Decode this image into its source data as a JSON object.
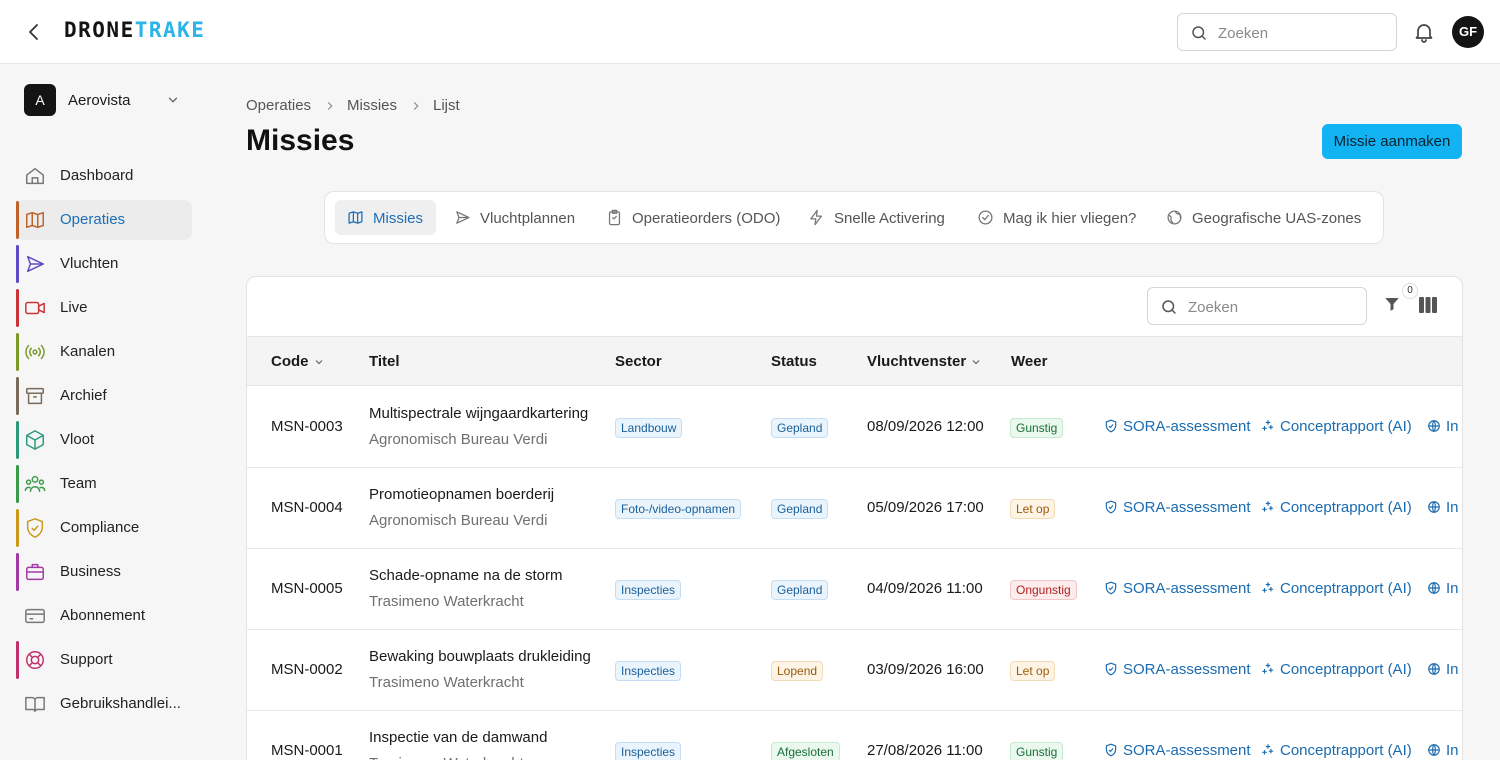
{
  "header": {
    "logo_part1": "DRONE",
    "logo_part2": "TRAKE",
    "search_placeholder": "Zoeken",
    "avatar_initials": "GF"
  },
  "sidebar": {
    "org_initial": "A",
    "org_name": "Aerovista",
    "items": [
      {
        "label": "Dashboard",
        "icon": "home-icon",
        "color": ""
      },
      {
        "label": "Operaties",
        "icon": "map-icon",
        "color": "#c0622a"
      },
      {
        "label": "Vluchten",
        "icon": "send-icon",
        "color": "#5b4bc4"
      },
      {
        "label": "Live",
        "icon": "video-icon",
        "color": "#c8343a"
      },
      {
        "label": "Kanalen",
        "icon": "broadcast-icon",
        "color": "#7a9a2a"
      },
      {
        "label": "Archief",
        "icon": "archive-icon",
        "color": "#7a6a5a"
      },
      {
        "label": "Vloot",
        "icon": "box-icon",
        "color": "#2a9a7a"
      },
      {
        "label": "Team",
        "icon": "users-icon",
        "color": "#3a9a4a"
      },
      {
        "label": "Compliance",
        "icon": "shield-icon",
        "color": "#c99a1a"
      },
      {
        "label": "Business",
        "icon": "briefcase-icon",
        "color": "#a23aa6"
      },
      {
        "label": "Abonnement",
        "icon": "credit-card-icon",
        "color": ""
      },
      {
        "label": "Support",
        "icon": "lifebuoy-icon",
        "color": "#c0306a"
      },
      {
        "label": "Gebruikshandlei...",
        "icon": "book-icon",
        "color": ""
      }
    ]
  },
  "breadcrumb": [
    "Operaties",
    "Missies",
    "Lijst"
  ],
  "page_title": "Missies",
  "create_button": "Missie aanmaken",
  "tabs": [
    {
      "label": "Missies",
      "icon": "map-icon"
    },
    {
      "label": "Vluchtplannen",
      "icon": "send-icon"
    },
    {
      "label": "Operatieorders (ODO)",
      "icon": "clipboard-icon"
    },
    {
      "label": "Snelle Activering",
      "icon": "zap-icon"
    },
    {
      "label": "Mag ik hier vliegen?",
      "icon": "check-circle-icon"
    },
    {
      "label": "Geografische UAS-zones",
      "icon": "globe-icon"
    }
  ],
  "table": {
    "search_placeholder": "Zoeken",
    "filter_count": "0",
    "columns": [
      "Code",
      "Titel",
      "Sector",
      "Status",
      "Vluchtvenster",
      "Weer"
    ],
    "actions": [
      "SORA-assessment",
      "Conceptrapport (AI)",
      "In"
    ],
    "rows": [
      {
        "code": "MSN-0003",
        "title": "Multispectrale wijngaardkartering",
        "client": "Agronomisch Bureau Verdi",
        "sector": "Landbouw",
        "status": "Gepland",
        "status_style": "blue",
        "window": "08/09/2026 12:00",
        "weather": "Gunstig",
        "weather_style": "green"
      },
      {
        "code": "MSN-0004",
        "title": "Promotieopnamen boerderij",
        "client": "Agronomisch Bureau Verdi",
        "sector": "Foto-/video-opnamen",
        "status": "Gepland",
        "status_style": "blue",
        "window": "05/09/2026 17:00",
        "weather": "Let op",
        "weather_style": "orange"
      },
      {
        "code": "MSN-0005",
        "title": "Schade-opname na de storm",
        "client": "Trasimeno Waterkracht",
        "sector": "Inspecties",
        "status": "Gepland",
        "status_style": "blue",
        "window": "04/09/2026 11:00",
        "weather": "Ongunstig",
        "weather_style": "red"
      },
      {
        "code": "MSN-0002",
        "title": "Bewaking bouwplaats drukleiding",
        "client": "Trasimeno Waterkracht",
        "sector": "Inspecties",
        "status": "Lopend",
        "status_style": "orange",
        "window": "03/09/2026 16:00",
        "weather": "Let op",
        "weather_style": "orange"
      },
      {
        "code": "MSN-0001",
        "title": "Inspectie van de damwand",
        "client": "Trasimeno Waterkracht",
        "sector": "Inspecties",
        "status": "Afgesloten",
        "status_style": "green",
        "window": "27/08/2026 11:00",
        "weather": "Gunstig",
        "weather_style": "green"
      }
    ]
  }
}
